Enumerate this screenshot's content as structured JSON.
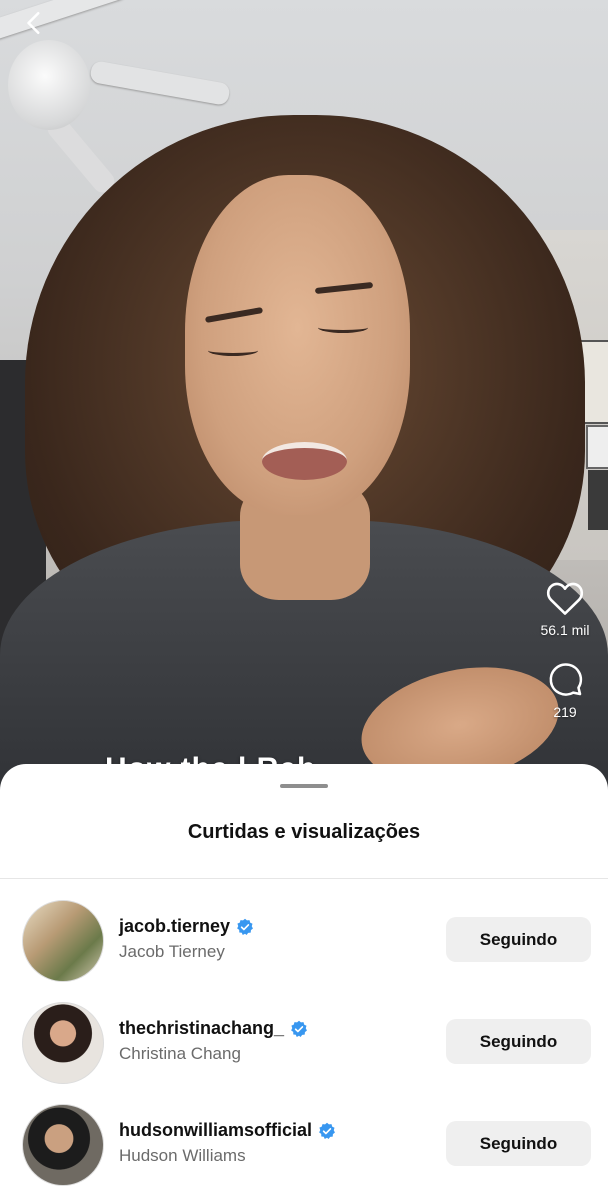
{
  "video": {
    "likes_count": "56.1 mil",
    "comments_count": "219",
    "caption_peek": "How  the  l           Reb"
  },
  "sheet": {
    "title": "Curtidas e visualizações"
  },
  "users": [
    {
      "username": "jacob.tierney",
      "full_name": "Jacob Tierney",
      "button_label": "Seguindo",
      "verified": true
    },
    {
      "username": "thechristinachang_",
      "full_name": "Christina Chang",
      "button_label": "Seguindo",
      "verified": true
    },
    {
      "username": "hudsonwilliamsofficial",
      "full_name": "Hudson Williams",
      "button_label": "Seguindo",
      "verified": true
    }
  ],
  "colors": {
    "verified": "#3897f0",
    "button_bg": "#efefef",
    "secondary_text": "#6b6b6b"
  }
}
